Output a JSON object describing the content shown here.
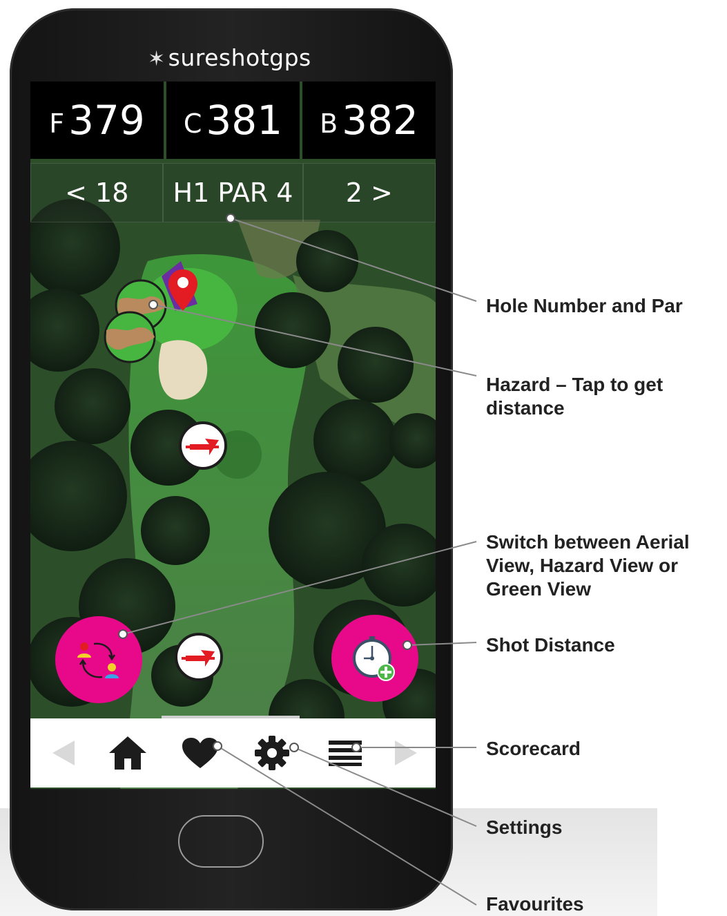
{
  "app": {
    "brand": "sureshotgps"
  },
  "distances": [
    {
      "label": "F",
      "value": "379"
    },
    {
      "label": "C",
      "value": "381"
    },
    {
      "label": "B",
      "value": "382"
    }
  ],
  "hole_nav": {
    "prev": "< 18",
    "current": "H1 PAR 4",
    "next": "2 >"
  },
  "colors": {
    "accent": "#e8088a",
    "pin": "#e31c24",
    "bunker": "#e8dcc0"
  },
  "icons": {
    "view_switch": "view-switch-icon",
    "shot_distance": "stopwatch-add-icon",
    "home": "home-icon",
    "favourites": "heart-icon",
    "settings": "gear-icon",
    "scorecard": "menu-lines-icon",
    "pin": "map-pin-icon",
    "layup": "direction-arrow-icon"
  },
  "callouts": {
    "hole": "Hole Number and Par",
    "hazard": "Hazard – Tap to get distance",
    "view": "Switch between Aerial View, Hazard View or Green View",
    "shot": "Shot Distance",
    "scorecard": "Scorecard",
    "settings": "Settings",
    "favourites": "Favourites"
  }
}
